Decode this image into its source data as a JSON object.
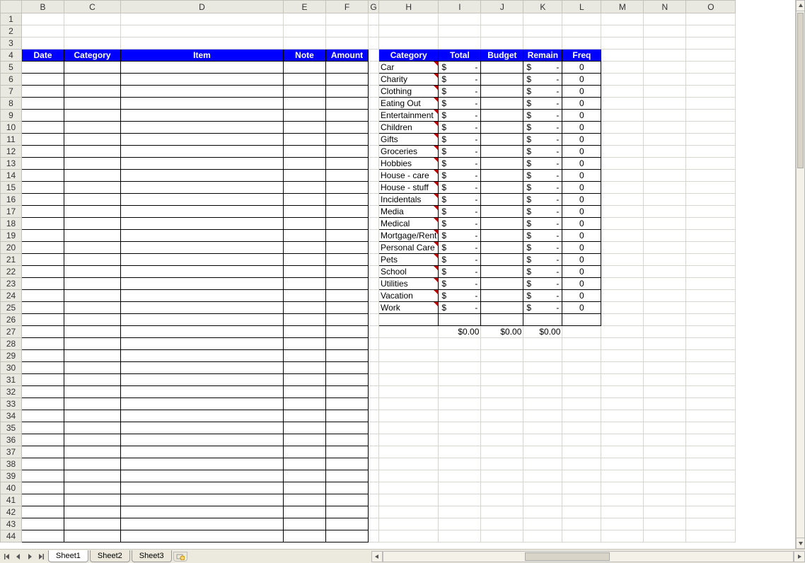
{
  "columns": [
    "B",
    "C",
    "D",
    "E",
    "F",
    "G",
    "H",
    "I",
    "J",
    "K",
    "L",
    "M",
    "N",
    "O"
  ],
  "row_numbers": [
    1,
    2,
    3,
    4,
    5,
    6,
    7,
    8,
    9,
    10,
    11,
    12,
    13,
    14,
    15,
    16,
    17,
    18,
    19,
    20,
    21,
    22,
    23,
    24,
    25,
    26,
    27,
    28,
    29,
    30,
    31,
    32,
    33,
    34,
    35,
    36,
    37,
    38,
    39,
    40,
    41,
    42,
    43,
    44
  ],
  "left_headers": [
    "Date",
    "Category",
    "Item",
    "Note",
    "Amount"
  ],
  "right_headers": [
    "Category",
    "Total",
    "Budget",
    "Remain",
    "Freq"
  ],
  "categories": [
    {
      "name": "Car",
      "total": "$       -",
      "budget": "",
      "remain": "$       -",
      "freq": "0"
    },
    {
      "name": "Charity",
      "total": "$       -",
      "budget": "",
      "remain": "$       -",
      "freq": "0"
    },
    {
      "name": "Clothing",
      "total": "$       -",
      "budget": "",
      "remain": "$       -",
      "freq": "0"
    },
    {
      "name": "Eating Out",
      "total": "$       -",
      "budget": "",
      "remain": "$       -",
      "freq": "0"
    },
    {
      "name": "Entertainment",
      "total": "$       -",
      "budget": "",
      "remain": "$       -",
      "freq": "0"
    },
    {
      "name": "Children",
      "total": "$       -",
      "budget": "",
      "remain": "$       -",
      "freq": "0"
    },
    {
      "name": "Gifts",
      "total": "$       -",
      "budget": "",
      "remain": "$       -",
      "freq": "0"
    },
    {
      "name": "Groceries",
      "total": "$       -",
      "budget": "",
      "remain": "$       -",
      "freq": "0"
    },
    {
      "name": "Hobbies",
      "total": "$       -",
      "budget": "",
      "remain": "$       -",
      "freq": "0"
    },
    {
      "name": "House - care",
      "total": "$       -",
      "budget": "",
      "remain": "$       -",
      "freq": "0"
    },
    {
      "name": "House - stuff",
      "total": "$       -",
      "budget": "",
      "remain": "$       -",
      "freq": "0"
    },
    {
      "name": "Incidentals",
      "total": "$       -",
      "budget": "",
      "remain": "$       -",
      "freq": "0"
    },
    {
      "name": "Media",
      "total": "$       -",
      "budget": "",
      "remain": "$       -",
      "freq": "0"
    },
    {
      "name": "Medical",
      "total": "$       -",
      "budget": "",
      "remain": "$       -",
      "freq": "0"
    },
    {
      "name": "Mortgage/Rent",
      "total": "$       -",
      "budget": "",
      "remain": "$       -",
      "freq": "0"
    },
    {
      "name": "Personal Care",
      "total": "$       -",
      "budget": "",
      "remain": "$       -",
      "freq": "0"
    },
    {
      "name": "Pets",
      "total": "$       -",
      "budget": "",
      "remain": "$       -",
      "freq": "0"
    },
    {
      "name": "School",
      "total": "$       -",
      "budget": "",
      "remain": "$       -",
      "freq": "0"
    },
    {
      "name": "Utilities",
      "total": "$       -",
      "budget": "",
      "remain": "$       -",
      "freq": "0"
    },
    {
      "name": "Vacation",
      "total": "$       -",
      "budget": "",
      "remain": "$       -",
      "freq": "0"
    },
    {
      "name": "Work",
      "total": "$       -",
      "budget": "",
      "remain": "$       -",
      "freq": "0"
    }
  ],
  "totals_row": {
    "total": "$0.00",
    "budget": "$0.00",
    "remain": "$0.00"
  },
  "tabs": [
    "Sheet1",
    "Sheet2",
    "Sheet3"
  ],
  "active_tab": 0,
  "colors": {
    "header_bg": "#0000ff",
    "header_fg": "#ffffff"
  }
}
